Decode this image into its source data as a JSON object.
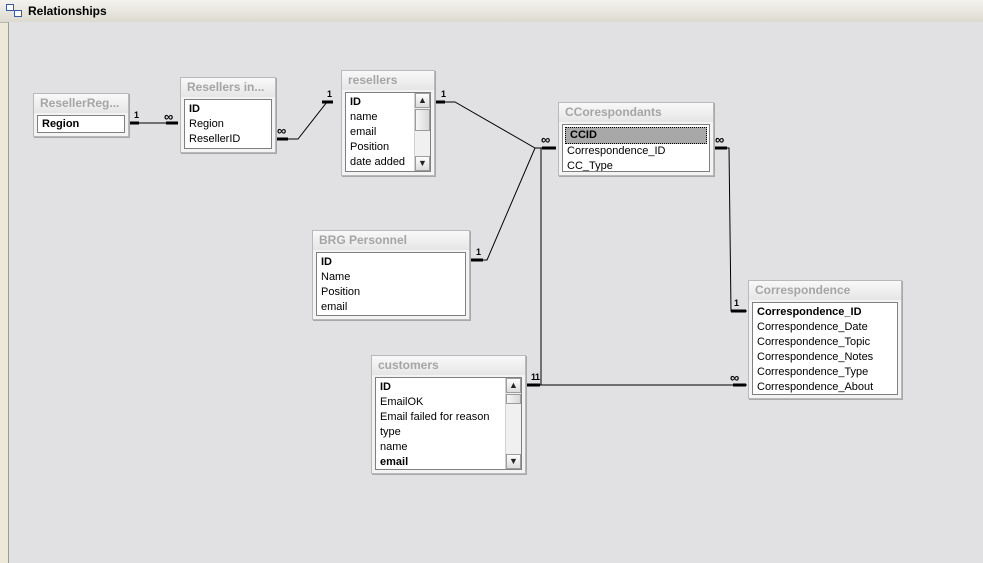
{
  "window": {
    "title": "Relationships"
  },
  "tables": {
    "reseller_regions": {
      "title": "ResellerReg...",
      "fields": [
        "Region"
      ]
    },
    "resellers_in": {
      "title": "Resellers in...",
      "fields": [
        "ID",
        "Region",
        "ResellerID"
      ]
    },
    "resellers": {
      "title": "resellers",
      "fields": [
        "ID",
        "name",
        "email",
        "Position",
        "date added"
      ]
    },
    "ccorespondants": {
      "title": "CCorespondants",
      "fields": [
        "CCID",
        "Correspondence_ID",
        "CC_Type"
      ]
    },
    "brg_personnel": {
      "title": "BRG Personnel",
      "fields": [
        "ID",
        "Name",
        "Position",
        "email"
      ]
    },
    "customers": {
      "title": "customers",
      "fields": [
        "ID",
        "EmailOK",
        "Email failed for reason",
        "type",
        "name",
        "email"
      ]
    },
    "correspondence": {
      "title": "Correspondence",
      "fields": [
        "Correspondence_ID",
        "Correspondence_Date",
        "Correspondence_Topic",
        "Correspondence_Notes",
        "Correspondence_Type",
        "Correspondence_About"
      ]
    }
  },
  "relationships": {
    "one": "1",
    "many": "∞"
  }
}
